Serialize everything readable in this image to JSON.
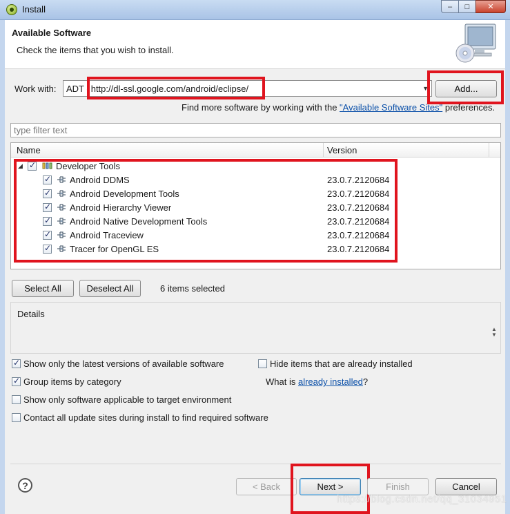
{
  "window": {
    "title": "Install",
    "minimize": "‒",
    "maximize": "□",
    "close": "✕"
  },
  "header": {
    "title": "Available Software",
    "subtitle": "Check the items that you wish to install."
  },
  "work_with": {
    "label": "Work with:",
    "value_prefix": "ADT - ",
    "value_url": "http://dl-ssl.google.com/android/eclipse/",
    "add_button": "Add...",
    "hint_before": "Find more software by working with the ",
    "hint_link": "\"Available Software Sites\"",
    "hint_after": " preferences."
  },
  "filter": {
    "placeholder": "type filter text"
  },
  "table": {
    "columns": [
      "Name",
      "Version"
    ],
    "group": {
      "label": "Developer Tools",
      "checked": true,
      "expanded": true
    },
    "items": [
      {
        "name": "Android DDMS",
        "version": "23.0.7.2120684",
        "checked": true
      },
      {
        "name": "Android Development Tools",
        "version": "23.0.7.2120684",
        "checked": true
      },
      {
        "name": "Android Hierarchy Viewer",
        "version": "23.0.7.2120684",
        "checked": true
      },
      {
        "name": "Android Native Development Tools",
        "version": "23.0.7.2120684",
        "checked": true
      },
      {
        "name": "Android Traceview",
        "version": "23.0.7.2120684",
        "checked": true
      },
      {
        "name": "Tracer for OpenGL ES",
        "version": "23.0.7.2120684",
        "checked": true
      }
    ]
  },
  "selection": {
    "select_all": "Select All",
    "deselect_all": "Deselect All",
    "count_text": "6 items selected"
  },
  "details": {
    "label": "Details"
  },
  "options": {
    "latest_versions": {
      "label": "Show only the latest versions of available software",
      "checked": true
    },
    "hide_installed": {
      "label": "Hide items that are already installed",
      "checked": false
    },
    "group_by_category": {
      "label": "Group items by category",
      "checked": true
    },
    "what_is_prefix": "What is ",
    "what_is_link": "already installed",
    "what_is_suffix": "?",
    "target_env": {
      "label": "Show only software applicable to target environment",
      "checked": false
    },
    "contact_sites": {
      "label": "Contact all update sites during install to find required software",
      "checked": false
    }
  },
  "footer": {
    "help": "?",
    "back": "< Back",
    "next": "Next >",
    "finish": "Finish",
    "cancel": "Cancel",
    "watermark": "https://blog.csdn.net/qq_31034951"
  },
  "colors": {
    "highlight_red": "#e0141e",
    "link_blue": "#0a4fa8"
  }
}
